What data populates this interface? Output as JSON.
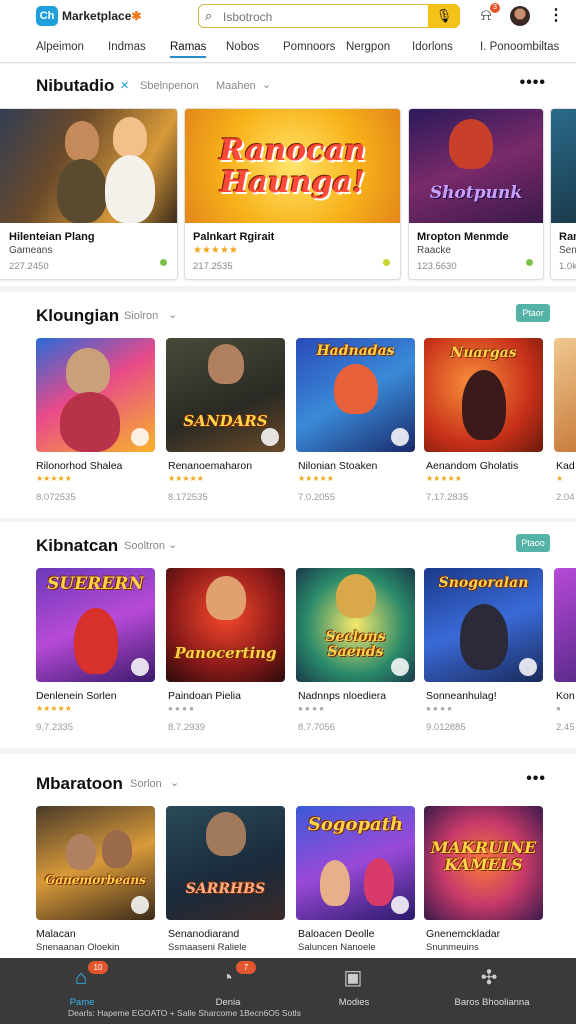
{
  "header": {
    "logo_text": "Ch",
    "brand": "Marketplace",
    "brand_mark": "✱",
    "search_placeholder": "Isbotroch",
    "notif_badge": "3"
  },
  "tabs": [
    "Alpeimon",
    "Indmas",
    "Ramas",
    "Nobos",
    "Pomnoors",
    "Nergpon",
    "Idorlons",
    "I. Ponoombiltas"
  ],
  "featured": {
    "title": "Nibutadio",
    "sub1": "Sbelnpenon",
    "sub2": "Maahen",
    "cards": [
      {
        "art_text": "",
        "title": "Hilenteian Plang",
        "sub": "Gameans",
        "meta": "227.2450"
      },
      {
        "art_text": "Ranocan Haunga!",
        "title": "Palnkart Rgirait",
        "sub": "★★★★★",
        "meta": "217.2535"
      },
      {
        "art_text": "Shotpunk",
        "title": "Mropton Menmde",
        "sub": "Raacke",
        "meta": "123.5630"
      },
      {
        "art_text": "",
        "title": "Ram",
        "sub": "Sen",
        "meta": "1.0k"
      }
    ]
  },
  "sections": [
    {
      "title": "Kloungian",
      "sub": "Siolron",
      "action": "Ptaor",
      "tiles": [
        {
          "art_text": "",
          "label": "Rilonorhod Shalea",
          "stars": "★★★★★",
          "meta": "8.072535"
        },
        {
          "art_text": "SANDARS",
          "label": "Renanoemaharon",
          "stars": "★★★★★",
          "meta": "8.172535"
        },
        {
          "art_text": "Hadnadas",
          "label": "Nilonian Stoaken",
          "stars": "★★★★★",
          "meta": "7.0.2055"
        },
        {
          "art_text": "Nuargas",
          "label": "Aenandom Gholatis",
          "stars": "★★★★★",
          "meta": "7.17.2835"
        },
        {
          "art_text": "",
          "label": "Kad",
          "stars": "★",
          "meta": "2.04"
        }
      ]
    },
    {
      "title": "Kibnatcan",
      "sub": "Sooltron",
      "action": "Ptaoo",
      "tiles": [
        {
          "art_text": "SUERERN",
          "label": "Denlenein Sorlen",
          "stars": "★★★★★",
          "meta": "9.7.2335"
        },
        {
          "art_text": "Panocerting",
          "label": "Paindoan Pielia",
          "stars": "● ● ● ●",
          "meta": "8.7.2939"
        },
        {
          "art_text": "Seclons Saends",
          "label": "Nadnnps nloediera",
          "stars": "● ● ● ●",
          "meta": "8.7.7056"
        },
        {
          "art_text": "Snogoralan",
          "label": "Sonneanhulag!",
          "stars": "● ● ● ●",
          "meta": "9.012885"
        },
        {
          "art_text": "",
          "label": "Kon",
          "stars": "●",
          "meta": "2.45"
        }
      ]
    },
    {
      "title": "Mbaratoon",
      "sub": "Sorlon",
      "tiles": [
        {
          "art_text": "Ganemorbeans",
          "label": "Malacan",
          "stars": "Snenaanan Oloekin",
          "meta": ""
        },
        {
          "art_text": "SARRHBS",
          "label": "Senanodiarand",
          "stars": "Ssmaaseni Raliele",
          "meta": ""
        },
        {
          "art_text": "Sogopath",
          "label": "Baloacen Deolle",
          "stars": "Saluncen Nanoele",
          "meta": ""
        },
        {
          "art_text": "MAKRUINE KAMELS",
          "label": "Gnenemckladar",
          "stars": "Snunmeuins",
          "meta": ""
        }
      ]
    }
  ],
  "bottom_nav": [
    {
      "icon": "home-icon",
      "glyph": "⌂",
      "label": "Pame",
      "badge": "10"
    },
    {
      "icon": "timer-icon",
      "glyph": "◔",
      "label": "Denia",
      "badge": "7"
    },
    {
      "icon": "controller-icon",
      "glyph": "▣",
      "label": "Modies",
      "badge": ""
    },
    {
      "icon": "apps-icon",
      "glyph": "✣",
      "label": "Baros Bhoolianna",
      "badge": ""
    }
  ],
  "footer_text": "Dearls: Hapeme EGOATO + Salle Sharcome 1Becn6O5 Sotls"
}
